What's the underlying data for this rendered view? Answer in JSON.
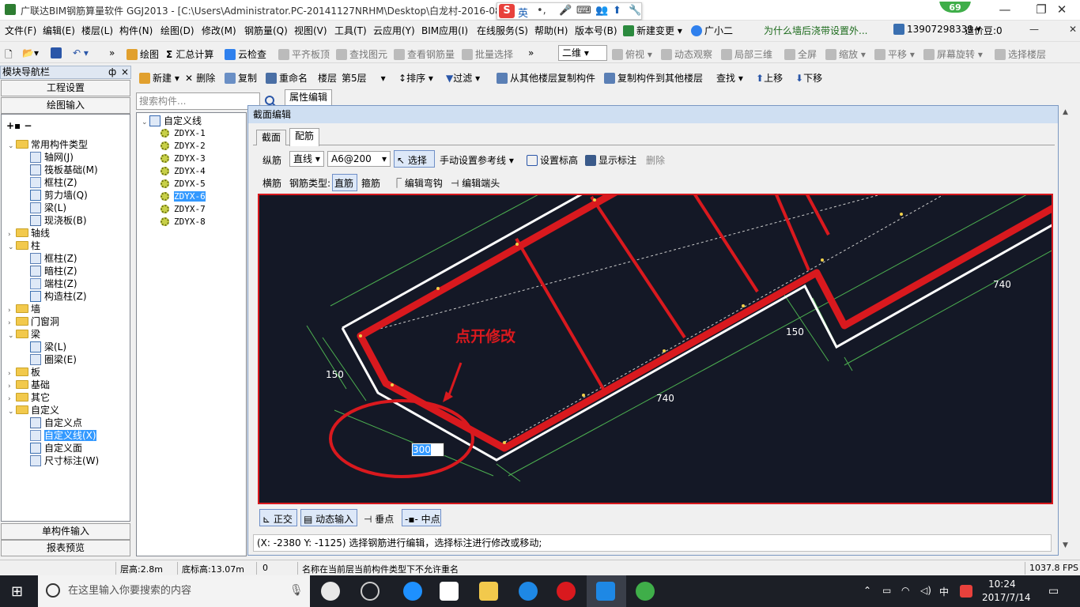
{
  "title_bar": {
    "title": "广联达BIM钢筋算量软件 GGJ2013 - [C:\\Users\\Administrator.PC-20141127NRHM\\Desktop\\白龙村-2016-08-",
    "badge": "69"
  },
  "ime": {
    "logo": "S",
    "lang": "英"
  },
  "menu": {
    "items": [
      "文件(F)",
      "编辑(E)",
      "楼层(L)",
      "构件(N)",
      "绘图(D)",
      "修改(M)",
      "钢筋量(Q)",
      "视图(V)",
      "工具(T)",
      "云应用(Y)",
      "BIM应用(I)",
      "在线服务(S)",
      "帮助(H)",
      "版本号(B)"
    ],
    "new_change": "新建变更",
    "assistant": "广小二",
    "promo": "为什么墙后浇带设置外...",
    "phone": "13907298339",
    "price": "造价豆:0"
  },
  "toolbar1": {
    "draw": "绘图",
    "sum": "汇总计算",
    "cloud_check": "云检查",
    "flat_top": "平齐板顶",
    "find_elem": "查找图元",
    "view_rebar": "查看钢筋量",
    "batch_select": "批量选择",
    "view_mode": "二维",
    "top_view": "俯视",
    "dynamic_view": "动态观察",
    "local_3d": "局部三维",
    "fullscreen": "全屏",
    "zoom": "缩放",
    "pan": "平移",
    "rotate": "屏幕旋转",
    "select_floor": "选择楼层"
  },
  "nav": {
    "header": "模块导航栏",
    "pin": "ф",
    "close": "×",
    "project_settings": "工程设置",
    "drawing_input": "绘图输入",
    "single_input": "单构件输入",
    "report_preview": "报表预览",
    "tree": [
      {
        "label": "常用构件类型",
        "level": 0,
        "type": "folder",
        "expanded": true
      },
      {
        "label": "轴网(J)",
        "level": 1,
        "type": "item"
      },
      {
        "label": "筏板基础(M)",
        "level": 1,
        "type": "item"
      },
      {
        "label": "框柱(Z)",
        "level": 1,
        "type": "item"
      },
      {
        "label": "剪力墙(Q)",
        "level": 1,
        "type": "item"
      },
      {
        "label": "梁(L)",
        "level": 1,
        "type": "item"
      },
      {
        "label": "现浇板(B)",
        "level": 1,
        "type": "item"
      },
      {
        "label": "轴线",
        "level": 0,
        "type": "folder",
        "expanded": false
      },
      {
        "label": "柱",
        "level": 0,
        "type": "folder",
        "expanded": true
      },
      {
        "label": "框柱(Z)",
        "level": 1,
        "type": "item"
      },
      {
        "label": "暗柱(Z)",
        "level": 1,
        "type": "item"
      },
      {
        "label": "端柱(Z)",
        "level": 1,
        "type": "item"
      },
      {
        "label": "构造柱(Z)",
        "level": 1,
        "type": "item"
      },
      {
        "label": "墙",
        "level": 0,
        "type": "folder",
        "expanded": false
      },
      {
        "label": "门窗洞",
        "level": 0,
        "type": "folder",
        "expanded": false
      },
      {
        "label": "梁",
        "level": 0,
        "type": "folder",
        "expanded": true
      },
      {
        "label": "梁(L)",
        "level": 1,
        "type": "item"
      },
      {
        "label": "圈梁(E)",
        "level": 1,
        "type": "item"
      },
      {
        "label": "板",
        "level": 0,
        "type": "folder",
        "expanded": false
      },
      {
        "label": "基础",
        "level": 0,
        "type": "folder",
        "expanded": false
      },
      {
        "label": "其它",
        "level": 0,
        "type": "folder",
        "expanded": false
      },
      {
        "label": "自定义",
        "level": 0,
        "type": "folder",
        "expanded": true
      },
      {
        "label": "自定义点",
        "level": 1,
        "type": "item"
      },
      {
        "label": "自定义线(X)",
        "level": 1,
        "type": "item",
        "selected": true
      },
      {
        "label": "自定义面",
        "level": 1,
        "type": "item"
      },
      {
        "label": "尺寸标注(W)",
        "level": 1,
        "type": "item"
      }
    ]
  },
  "toolbar2": {
    "new": "新建",
    "delete": "删除",
    "copy": "复制",
    "rename": "重命名",
    "floor_label": "楼层",
    "floor_value": "第5层",
    "sort": "排序",
    "filter": "过滤",
    "copy_from_other": "从其他楼层复制构件",
    "copy_to_other": "复制构件到其他楼层",
    "find": "查找",
    "move_up": "上移",
    "move_down": "下移"
  },
  "component_panel": {
    "search_placeholder": "搜索构件...",
    "root": "自定义线",
    "items": [
      "ZDYX-1",
      "ZDYX-2",
      "ZDYX-3",
      "ZDYX-4",
      "ZDYX-5",
      "ZDYX-6",
      "ZDYX-7",
      "ZDYX-8"
    ],
    "selected_index": 5
  },
  "property_tab": "属性编辑",
  "dialog": {
    "title": "截面编辑",
    "tabs": [
      "截面",
      "配筋"
    ],
    "active_tab": 1,
    "row1": {
      "longitudinal": "纵筋",
      "line_type": "直线",
      "spec": "A6@200",
      "select": "选择",
      "manual_ref": "手动设置参考线",
      "set_elev": "设置标高",
      "show_mark": "显示标注",
      "delete": "删除"
    },
    "row2": {
      "transverse": "横筋",
      "rebar_type_label": "钢筋类型:",
      "straight": "直筋",
      "stirrup": "箍筋",
      "edit_hook": "编辑弯钩",
      "edit_end": "编辑端头"
    },
    "canvas": {
      "annotation": "点开修改",
      "dims": [
        "150",
        "740",
        "150",
        "740"
      ],
      "input_value": "300"
    },
    "bottom": {
      "ortho": "正交",
      "dynamic_input": "动态输入",
      "perp_point": "垂点",
      "mid_point": "中点"
    },
    "coord_text": "(X: -2380 Y: -1125) 选择钢筋进行编辑，选择标注进行修改或移动;"
  },
  "status": {
    "floor_height": "层高:2.8m",
    "base_elev": "底标高:13.07m",
    "zero": "0",
    "message": "名称在当前层当前构件类型下不允许重名",
    "fps": "1037.8 FPS"
  },
  "taskbar": {
    "search": "在这里输入你要搜索的内容",
    "ime": "中",
    "time": "10:24",
    "date": "2017/7/14"
  }
}
